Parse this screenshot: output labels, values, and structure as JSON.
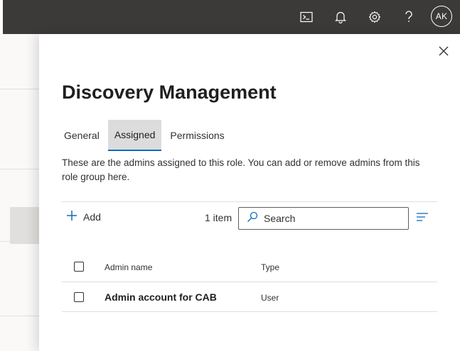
{
  "topbar": {
    "icons": [
      "terminal-icon",
      "bell-icon",
      "gear-icon",
      "help-icon"
    ],
    "avatar_initials": "AK",
    "background": "#3b3a39"
  },
  "panel": {
    "title": "Discovery Management",
    "tabs": [
      {
        "label": "General",
        "active": false
      },
      {
        "label": "Assigned",
        "active": true
      },
      {
        "label": "Permissions",
        "active": false
      }
    ],
    "description": "These are the admins assigned to this role. You can add or remove admins from this role group here.",
    "toolbar": {
      "add_label": "Add",
      "item_count": "1 item",
      "search_placeholder": "Search"
    },
    "table": {
      "columns": [
        "Admin name",
        "Type"
      ],
      "rows": [
        {
          "name": "Admin account for CAB",
          "type": "User"
        }
      ]
    },
    "accent_color": "#0f6cbd"
  }
}
